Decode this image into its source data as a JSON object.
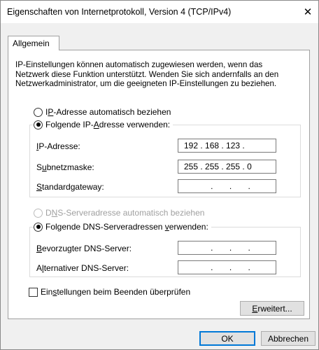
{
  "window": {
    "title": "Eigenschaften von Internetprotokoll, Version 4 (TCP/IPv4)",
    "close_glyph": "✕"
  },
  "tabs": [
    {
      "label": "Allgemein",
      "active": true
    }
  ],
  "intro_text": "IP-Einstellungen können automatisch zugewiesen werden, wenn das\nNetzwerk diese Funktion unterstützt. Wenden Sie sich andernfalls an den\nNetzwerkadministrator, um die geeigneten IP-Einstellungen zu beziehen.",
  "ip_section": {
    "auto_option": {
      "pre": "I",
      "u": "P",
      "post": "-Adresse automatisch beziehen",
      "checked": false
    },
    "manual_option": {
      "pre": "Folgende IP-",
      "u": "A",
      "post": "dresse verwenden:",
      "checked": true
    },
    "fields": [
      {
        "pre": "",
        "u": "I",
        "post": "P-Adresse:",
        "value": "192 . 168 . 123 ."
      },
      {
        "pre": "S",
        "u": "u",
        "post": "bnetzmaske:",
        "value": "255 . 255 . 255 . 0"
      },
      {
        "pre": "",
        "u": "S",
        "post": "tandardgateway:",
        "value": "   .       .       ."
      }
    ]
  },
  "dns_section": {
    "auto_option": {
      "pre": "D",
      "u": "N",
      "post": "S-Serveradresse automatisch beziehen",
      "checked": false,
      "disabled": true
    },
    "manual_option": {
      "pre": "Folgende DNS-Serveradressen ",
      "u": "v",
      "post": "erwenden:",
      "checked": true
    },
    "fields": [
      {
        "pre": "",
        "u": "B",
        "post": "evorzugter DNS-Server:",
        "value": "   .       .       ."
      },
      {
        "pre": "A",
        "u": "l",
        "post": "ternativer DNS-Server:",
        "value": "   .       .       ."
      }
    ]
  },
  "validate_checkbox": {
    "pre": "Ein",
    "u": "s",
    "post": "tellungen beim Beenden überprüfen",
    "checked": false
  },
  "buttons": {
    "advanced": {
      "pre": "",
      "u": "E",
      "post": "rweitert..."
    },
    "ok": "OK",
    "cancel": "Abbrechen"
  }
}
